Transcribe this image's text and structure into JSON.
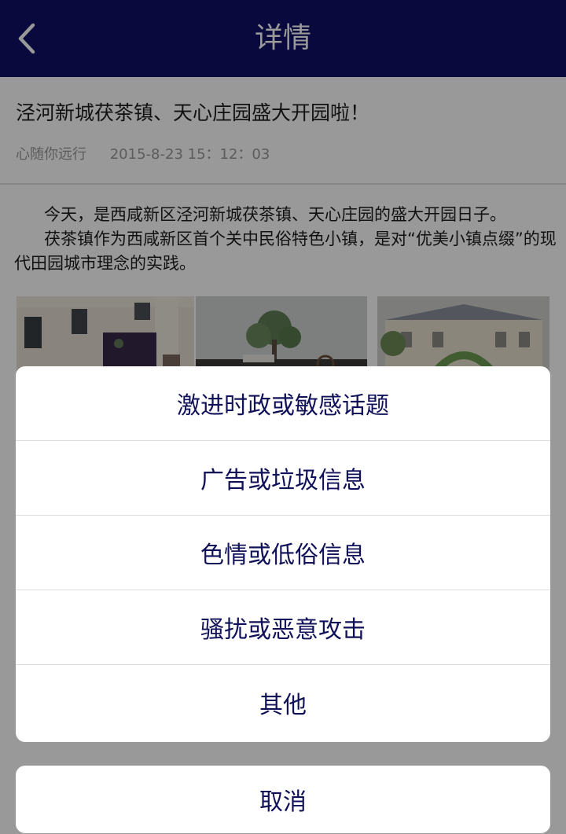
{
  "header": {
    "title": "详情",
    "back_icon": "chevron-left-icon"
  },
  "article": {
    "title": "泾河新城茯茶镇、天心庄园盛大开园啦！",
    "author": "心随你远行",
    "datetime": "2015-8-23  15：12：03",
    "paragraphs": [
      "今天，是西咸新区泾河新城茯茶镇、天心庄园的盛大开园日子。",
      "茯茶镇作为西咸新区首个关中民俗特色小镇，是对“优美小镇点缀”的现代田园城市理念的实践。"
    ]
  },
  "report_sheet": {
    "options": [
      "激进时政或敏感话题",
      "广告或垃圾信息",
      "色情或低俗信息",
      "骚扰或恶意攻击",
      "其他"
    ],
    "cancel_label": "取消"
  },
  "colors": {
    "header_bg": "#0f0f66",
    "option_text": "#11115a",
    "overlay": "rgba(0,0,0,0.40)"
  }
}
